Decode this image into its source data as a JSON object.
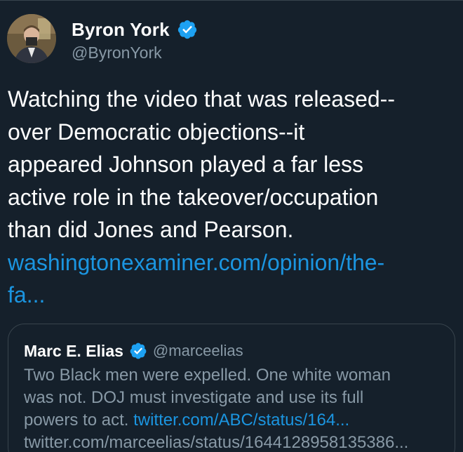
{
  "tweet": {
    "author": {
      "display_name": "Byron York",
      "handle": "@ByronYork",
      "verified": true,
      "avatar_icon": "profile-photo"
    },
    "text_lines": [
      "Watching the video that was released--",
      "over Democratic objections--it",
      "appeared Johnson played a far less",
      "active role in the takeover/occupation",
      "than did Jones and Pearson."
    ],
    "link_line_1": "washingtonexaminer.com/opinion/the-",
    "link_line_2": "fa..."
  },
  "quoted_tweet": {
    "author": {
      "display_name": "Marc E. Elias",
      "handle": "@marceelias",
      "verified": true
    },
    "text_line_1": "Two Black men were expelled. One white woman",
    "text_line_2": "was not. DOJ must investigate and use its full",
    "text_line_3_prefix": "powers to act. ",
    "text_line_3_link": "twitter.com/ABC/status/164...",
    "text_line_4": "twitter.com/marceelias/status/1644128958135386..."
  },
  "colors": {
    "background": "#15202b",
    "text_primary": "#ffffff",
    "text_secondary": "#8899a6",
    "link": "#1b95e0",
    "verified_badge": "#1da1f2",
    "border": "#38444d"
  }
}
